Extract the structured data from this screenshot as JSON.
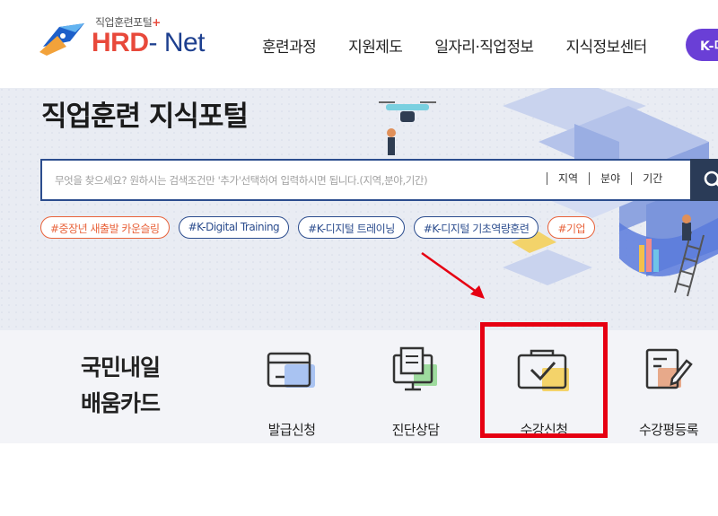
{
  "header": {
    "logo_subtitle": "직업훈련포털",
    "logo_plus": "+",
    "logo_hrd": "HRD",
    "logo_net": "- Net",
    "nav": [
      "훈련과정",
      "지원제도",
      "일자리·직업정보",
      "지식정보센터"
    ],
    "kdigital_label": "K-디"
  },
  "hero": {
    "title": "직업훈련 지식포털",
    "search": {
      "placeholder": "무엇을 찾으세요? 원하시는 검색조건만 '추가'선택하여 입력하시면 됩니다.(지역,분야,기간)",
      "filters": [
        "지역",
        "분야",
        "기간"
      ]
    },
    "tags": [
      {
        "label": "#중장년 새출발 카운슬링",
        "color": "orange"
      },
      {
        "label": "#K-Digital Training",
        "color": "blue"
      },
      {
        "label": "#K-디지털 트레이닝",
        "color": "blue"
      },
      {
        "label": "#K-디지털 기초역량훈련",
        "color": "blue"
      },
      {
        "label": "#기업",
        "color": "orange"
      }
    ]
  },
  "quick_menu": {
    "title_line1": "국민내일",
    "title_line2": "배움카드",
    "items": [
      {
        "label": "발급신청",
        "icon": "card-icon"
      },
      {
        "label": "진단상담",
        "icon": "monitor-document-icon"
      },
      {
        "label": "수강신청",
        "icon": "checked-folder-icon"
      },
      {
        "label": "수강평등록",
        "icon": "write-review-icon"
      }
    ]
  },
  "colors": {
    "brand_red": "#e8493b",
    "brand_navy": "#1d3f8f",
    "kdigital_purple": "#6a3fd6",
    "search_button": "#2a3b57",
    "tag_orange": "#e8633b",
    "tag_blue": "#2c4d8e",
    "highlight_red": "#e60012"
  }
}
